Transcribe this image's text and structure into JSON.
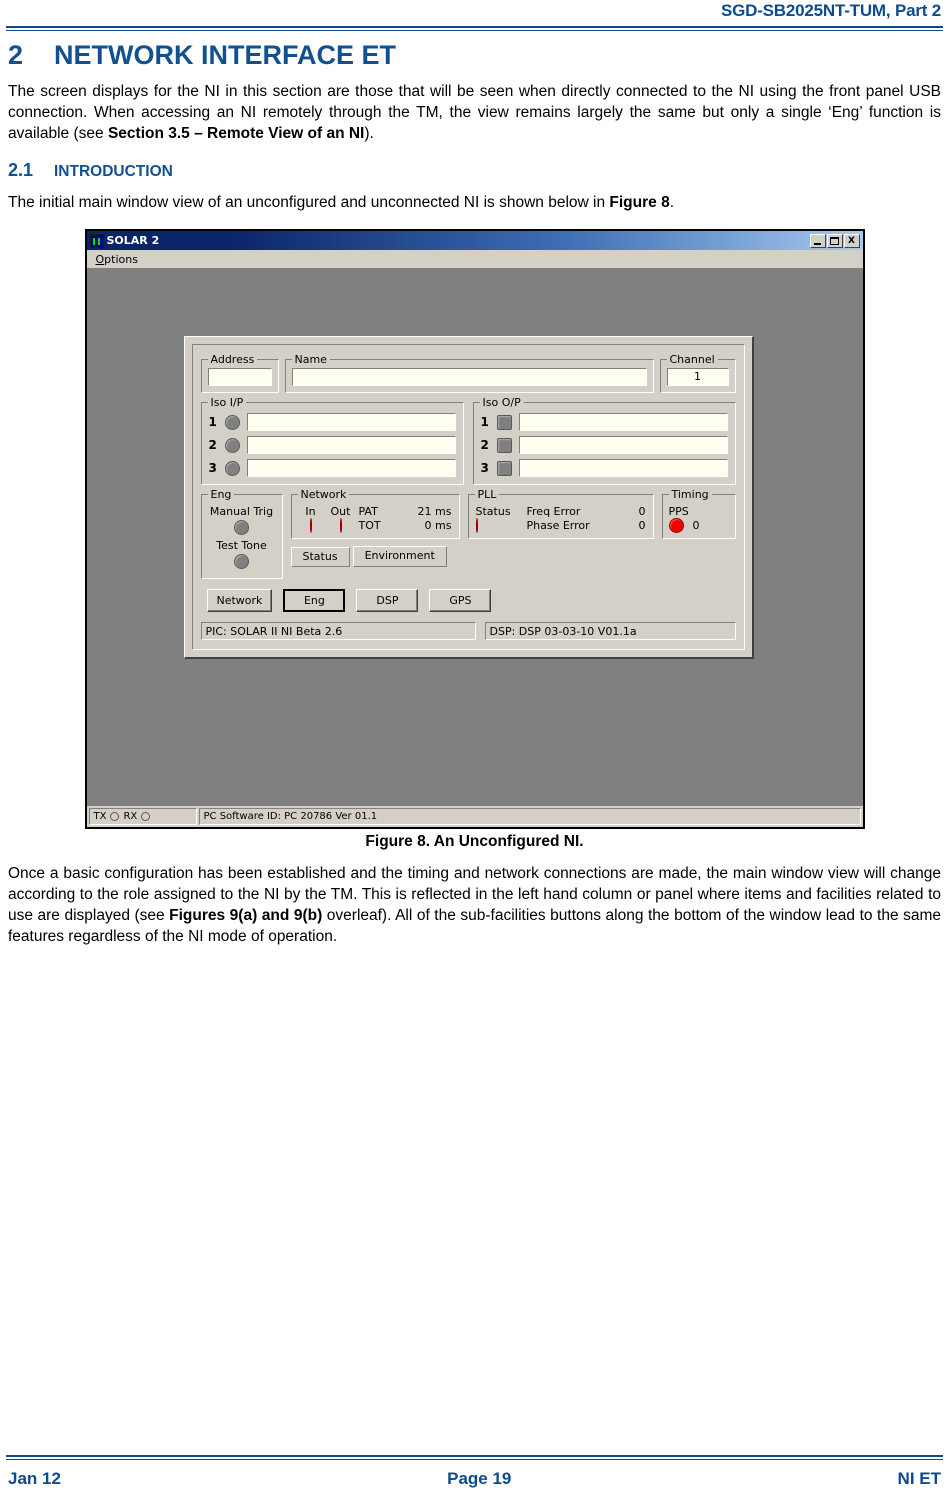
{
  "header": {
    "doc_ref": "SGD-SB2025NT-TUM, Part 2"
  },
  "section": {
    "number": "2",
    "title": "NETWORK INTERFACE ET",
    "intro_p1_a": "The screen displays for the NI in this section are those that will be seen when directly connected to the NI using the front panel USB connection.  When accessing an NI remotely through the TM, the view remains largely the same but only a single ‘Eng’ function is available (see ",
    "intro_p1_b": "Section 3.5 – Remote View of an NI",
    "intro_p1_c": ")."
  },
  "subsection": {
    "number": "2.1",
    "title": "INTRODUCTION",
    "para_a": "The initial main window view of an unconfigured and unconnected NI is shown below in ",
    "para_b": "Figure 8",
    "para_c": "."
  },
  "figure": {
    "caption": "Figure 8.  An Unconfigured NI."
  },
  "after_figure": {
    "para_a": "Once a basic configuration has been established and the timing and network connections are made, the main window view will change according to the role assigned to the NI by the TM.  This is reflected in the left hand column or panel where items and facilities related to use are displayed (see ",
    "para_b": "Figures 9(a) and 9(b)",
    "para_c": " overleaf).   All of the sub-facilities buttons along the bottom of the window lead to the same features regardless of the NI mode of operation."
  },
  "app_window": {
    "title": "SOLAR 2",
    "menu": [
      {
        "label": "Options",
        "mnemonic": "O"
      }
    ],
    "window_buttons": {
      "minimize": "_",
      "maximize": "□",
      "close": "X"
    },
    "address": {
      "label": "Address",
      "value": ""
    },
    "name": {
      "label": "Name",
      "value": ""
    },
    "channel": {
      "label": "Channel",
      "value": "1"
    },
    "iso_ip": {
      "label": "Iso I/P",
      "rows": [
        {
          "num": "1",
          "led": "grey",
          "value": ""
        },
        {
          "num": "2",
          "led": "grey",
          "value": ""
        },
        {
          "num": "3",
          "led": "grey",
          "value": ""
        }
      ]
    },
    "iso_op": {
      "label": "Iso O/P",
      "rows": [
        {
          "num": "1",
          "button": "grey",
          "value": ""
        },
        {
          "num": "2",
          "button": "grey",
          "value": ""
        },
        {
          "num": "3",
          "button": "grey",
          "value": ""
        }
      ]
    },
    "eng": {
      "label": "Eng",
      "manual_trig_label": "Manual Trig",
      "manual_trig_led": "grey",
      "test_tone_label": "Test Tone",
      "test_tone_led": "grey"
    },
    "network": {
      "label": "Network",
      "in_label": "In",
      "out_label": "Out",
      "in_led": "red",
      "out_led": "red",
      "pat_label": "PAT",
      "pat_value": "21 ms",
      "tot_label": "TOT",
      "tot_value": "0 ms"
    },
    "pll": {
      "label": "PLL",
      "status_label": "Status",
      "status_led": "red",
      "freq_error_label": "Freq Error",
      "freq_error_value": "0",
      "phase_error_label": "Phase Error",
      "phase_error_value": "0"
    },
    "timing": {
      "label": "Timing",
      "pps_label": "PPS",
      "pps_led": "red",
      "pps_value": "0"
    },
    "tabs": [
      {
        "label": "Status",
        "active": true
      },
      {
        "label": "Environment",
        "active": false
      }
    ],
    "buttons": [
      {
        "label": "Network",
        "focused": false
      },
      {
        "label": "Eng",
        "focused": true
      },
      {
        "label": "DSP",
        "focused": false
      },
      {
        "label": "GPS",
        "focused": false
      }
    ],
    "info": {
      "pic": "PIC: SOLAR II NI Beta 2.6",
      "dsp": "DSP: DSP 03-03-10 V01.1a"
    },
    "statusbar": {
      "tx_label": "TX",
      "rx_label": "RX",
      "software_id": "PC Software ID: PC 20786  Ver 01.1"
    },
    "colors": {
      "face": "#d4d0c8",
      "client": "#808080",
      "field": "#fffff0",
      "led_red": "#f00000",
      "led_grey": "#808080",
      "title_start": "#0a246a",
      "title_end": "#a6caf0"
    }
  },
  "footer": {
    "date": "Jan 12",
    "page": "Page 19",
    "doc_tag": "NI ET"
  }
}
